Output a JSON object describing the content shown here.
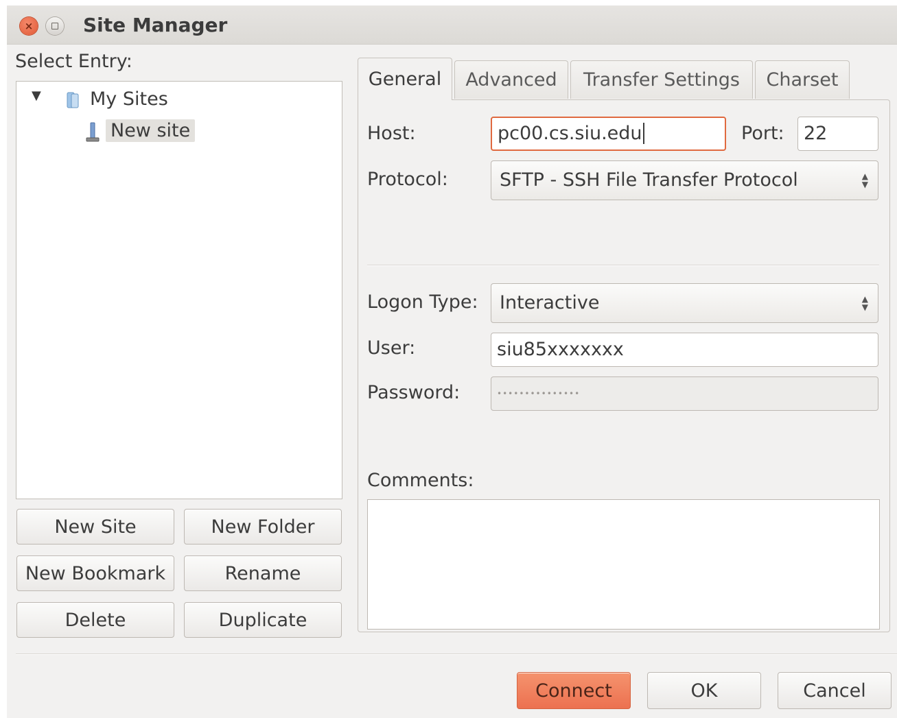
{
  "window": {
    "title": "Site Manager",
    "close_glyph": "×"
  },
  "left": {
    "select_entry_label": "Select Entry:",
    "tree": {
      "root_label": "My Sites",
      "root_expanded": true,
      "root_icon": "folder-icon",
      "child_label": "New site",
      "child_icon": "server-icon",
      "child_selected": true
    },
    "buttons": {
      "new_site": "New Site",
      "new_folder": "New Folder",
      "new_bookmark": "New Bookmark",
      "rename": "Rename",
      "delete": "Delete",
      "duplicate": "Duplicate"
    }
  },
  "tabs": [
    {
      "label": "General",
      "active": true
    },
    {
      "label": "Advanced",
      "active": false
    },
    {
      "label": "Transfer Settings",
      "active": false
    },
    {
      "label": "Charset",
      "active": false
    }
  ],
  "general": {
    "host_label": "Host:",
    "host_value": "pc00.cs.siu.edu",
    "port_label": "Port:",
    "port_value": "22",
    "protocol_label": "Protocol:",
    "protocol_value": "SFTP - SSH File Transfer Protocol",
    "logon_type_label": "Logon Type:",
    "logon_type_value": "Interactive",
    "user_label": "User:",
    "user_value": "siu85xxxxxxx",
    "password_label": "Password:",
    "password_value": "•••••••••••••••",
    "comments_label": "Comments:",
    "comments_value": ""
  },
  "footer": {
    "connect": "Connect",
    "ok": "OK",
    "cancel": "Cancel"
  },
  "colors": {
    "accent": "#ec7150",
    "focus_border": "#e0693f",
    "window_bg": "#f2f1f0"
  }
}
